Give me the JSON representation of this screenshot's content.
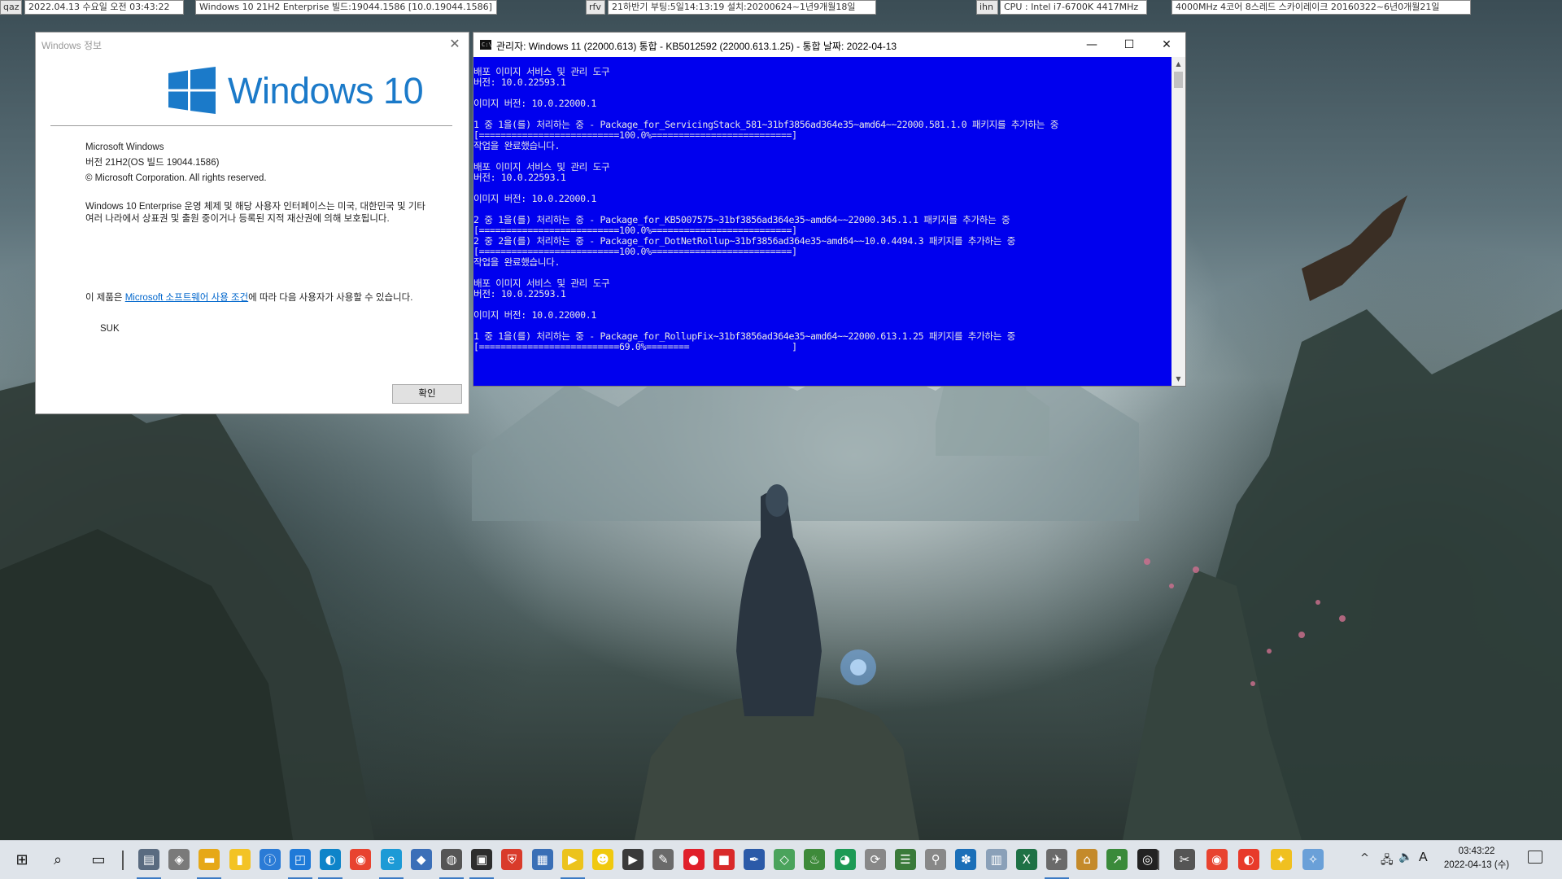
{
  "topbar": {
    "tag1": "qaz",
    "datetime": "2022.04.13 수요일 오전 03:43:22",
    "os_build": "Windows 10 21H2 Enterprise 빌드:19044.1586 [10.0.19044.1586]",
    "tag2": "rfv",
    "uptime": "21하반기 부팅:5일14:13:19 설치:20200624~1년9개월18일",
    "tag3": "ihn",
    "cpu": "CPU : Intel i7-6700K 4417MHz",
    "memory": "4000MHz 4코어 8스레드 스카이레이크 20160322~6년0개월21일"
  },
  "about": {
    "title": "Windows 정보",
    "product_name": "Windows 10",
    "line1": "Microsoft Windows",
    "line2": "버전 21H2(OS 빌드 19044.1586)",
    "line3": "© Microsoft Corporation. All rights reserved.",
    "legal": "Windows 10 Enterprise 운영 체제 및 해당 사용자 인터페이스는 미국, 대한민국 및 기타 여러 나라에서 상표권 및 출원 중이거나 등록된 지적 재산권에 의해 보호됩니다.",
    "license_prefix": "이 제품은 ",
    "license_link": "Microsoft 소프트웨어 사용 조건",
    "license_suffix": "에 따라 다음 사용자가 사용할 수 있습니다.",
    "user": "SUK",
    "ok_label": "확인"
  },
  "console": {
    "title": "관리자:  Windows 11 (22000.613) 통합 - KB5012592 (22000.613.1.25) - 통합 날짜: 2022-04-13",
    "minimize": "—",
    "maximize": "☐",
    "close": "✕",
    "lines": [
      "배포 이미지 서비스 및 관리 도구",
      "버전: 10.0.22593.1",
      "",
      "이미지 버전: 10.0.22000.1",
      "",
      "1 중 1을(를) 처리하는 중 - Package_for_ServicingStack_581~31bf3856ad364e35~amd64~~22000.581.1.0 패키지를 추가하는 중",
      "[==========================100.0%==========================]",
      "작업을 완료했습니다.",
      "",
      "배포 이미지 서비스 및 관리 도구",
      "버전: 10.0.22593.1",
      "",
      "이미지 버전: 10.0.22000.1",
      "",
      "2 중 1을(를) 처리하는 중 - Package_for_KB5007575~31bf3856ad364e35~amd64~~22000.345.1.1 패키지를 추가하는 중",
      "[==========================100.0%==========================]",
      "2 중 2을(를) 처리하는 중 - Package_for_DotNetRollup~31bf3856ad364e35~amd64~~10.0.4494.3 패키지를 추가하는 중",
      "[==========================100.0%==========================]",
      "작업을 완료했습니다.",
      "",
      "배포 이미지 서비스 및 관리 도구",
      "버전: 10.0.22593.1",
      "",
      "이미지 버전: 10.0.22000.1",
      "",
      "1 중 1을(를) 처리하는 중 - Package_for_RollupFix~31bf3856ad364e35~amd64~~22000.613.1.25 패키지를 추가하는 중",
      "[==========================69.0%========                   ]"
    ]
  },
  "taskbar": {
    "clock_time": "03:43:22",
    "clock_date": "2022-04-13 (수)",
    "ime": "A",
    "icons": [
      "start-icon",
      "search-icon",
      "task-view-icon",
      "scanner-icon",
      "tool-icon",
      "file-explorer-icon",
      "notepad-icon",
      "info-icon",
      "window-icon",
      "edge-icon",
      "chrome-icon",
      "ie-icon",
      "box-icon",
      "disk-icon",
      "cmd-icon",
      "shield-icon",
      "monitor-icon",
      "potplayer-icon",
      "kakao-icon",
      "movie-icon",
      "edit-icon",
      "red-circle-icon",
      "red-box-icon",
      "feather-icon",
      "diamond-icon",
      "bottle-icon",
      "globe-icon",
      "refresh-icon",
      "network-icon",
      "pin-icon",
      "gear-icon",
      "doc-icon",
      "excel-icon",
      "plane-icon",
      "folder-icon",
      "chart-icon",
      "cd-icon",
      "scissors-icon",
      "chrome2-icon",
      "pie-icon",
      "star-icon",
      "bird-icon"
    ]
  },
  "colors": {
    "console_bg": "#0000ee",
    "console_text": "#e6e6e6",
    "win_blue": "#1b7ac9",
    "link": "#0066cc"
  }
}
